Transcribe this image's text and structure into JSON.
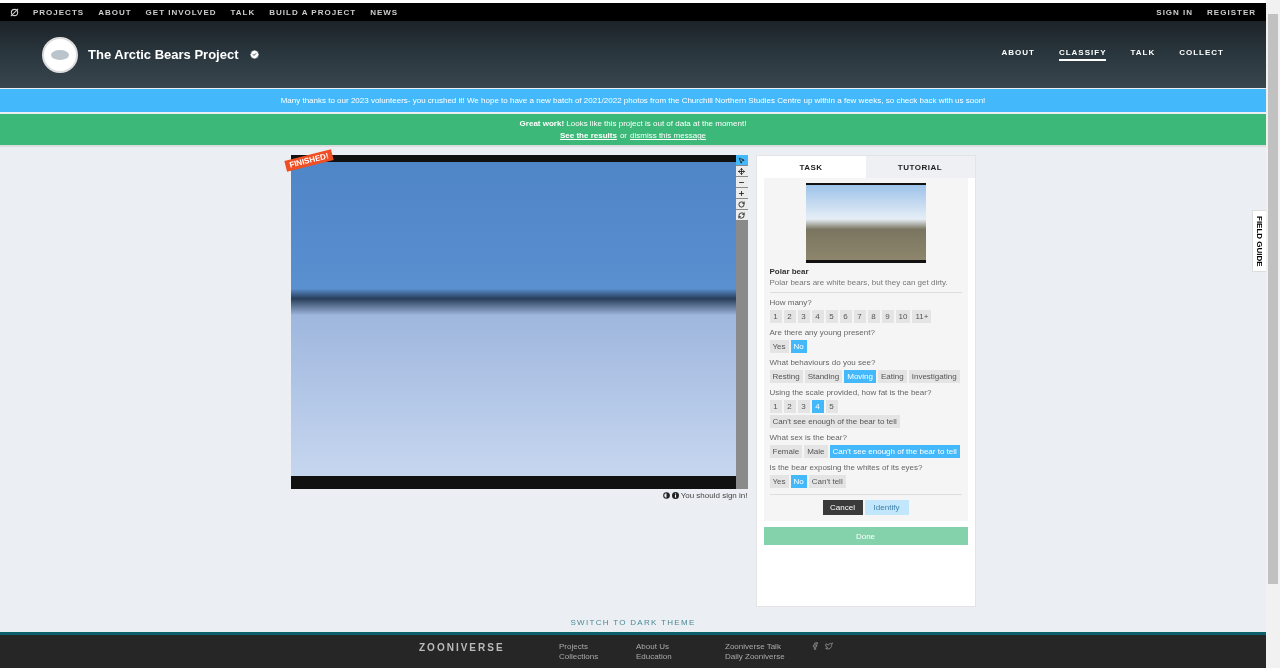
{
  "top_nav": {
    "links": [
      "PROJECTS",
      "ABOUT",
      "GET INVOLVED",
      "TALK",
      "BUILD A PROJECT",
      "NEWS"
    ],
    "account": [
      "SIGN IN",
      "REGISTER"
    ]
  },
  "project": {
    "title": "The Arctic Bears Project",
    "verified": true,
    "nav": [
      {
        "label": "ABOUT",
        "selected": false
      },
      {
        "label": "CLASSIFY",
        "selected": true
      },
      {
        "label": "TALK",
        "selected": false
      },
      {
        "label": "COLLECT",
        "selected": false
      }
    ]
  },
  "announcement": "Many thanks to our 2023 volunteers- you crushed it! We hope to have a new batch of 2021/2022 photos from the Churchill Northern Studies Centre up within a few weeks, so check back with us soon!",
  "finished_banner": {
    "message": "**Great work!** Looks like this project is out of data at the moment!",
    "results_link": "See the results",
    "or": "or",
    "dismiss_link": "dismiss this message"
  },
  "subject": {
    "badge": "FINISHED!",
    "sign_in_note": "You should sign in!",
    "tools": [
      {
        "kind": "pointer",
        "selected": true
      },
      {
        "kind": "move",
        "selected": false
      },
      {
        "kind": "zoom-out",
        "selected": false
      },
      {
        "kind": "zoom-in",
        "selected": false
      },
      {
        "kind": "rotate",
        "selected": false
      },
      {
        "kind": "reset",
        "selected": false
      }
    ]
  },
  "task_panel": {
    "tabs": [
      {
        "label": "TASK",
        "selected": true
      },
      {
        "label": "TUTORIAL",
        "selected": false
      }
    ],
    "species": "Polar bear",
    "description": "Polar bears are white bears, but they can get dirty.",
    "questions": [
      {
        "question": "How many?",
        "options": [
          {
            "label": "1",
            "selected": false
          },
          {
            "label": "2",
            "selected": false
          },
          {
            "label": "3",
            "selected": false
          },
          {
            "label": "4",
            "selected": false
          },
          {
            "label": "5",
            "selected": false
          },
          {
            "label": "6",
            "selected": false
          },
          {
            "label": "7",
            "selected": false
          },
          {
            "label": "8",
            "selected": false
          },
          {
            "label": "9",
            "selected": false
          },
          {
            "label": "10",
            "selected": false
          },
          {
            "label": "11+",
            "selected": false
          }
        ]
      },
      {
        "question": "Are there any young present?",
        "options": [
          {
            "label": "Yes",
            "selected": false
          },
          {
            "label": "No",
            "selected": true
          }
        ]
      },
      {
        "question": "What behaviours do you see?",
        "options": [
          {
            "label": "Resting",
            "selected": false
          },
          {
            "label": "Standing",
            "selected": false
          },
          {
            "label": "Moving",
            "selected": true
          },
          {
            "label": "Eating",
            "selected": false
          },
          {
            "label": "Investigating",
            "selected": false
          }
        ]
      },
      {
        "question": "Using the scale provided, how fat is the bear?",
        "options": [
          {
            "label": "1",
            "selected": false
          },
          {
            "label": "2",
            "selected": false
          },
          {
            "label": "3",
            "selected": false
          },
          {
            "label": "4",
            "selected": true
          },
          {
            "label": "5",
            "selected": false
          },
          {
            "label": "Can't see enough of the bear to tell",
            "selected": false
          }
        ]
      },
      {
        "question": "What sex is the bear?",
        "options": [
          {
            "label": "Female",
            "selected": false
          },
          {
            "label": "Male",
            "selected": false
          },
          {
            "label": "Can't see enough of the bear to tell",
            "selected": true
          }
        ]
      },
      {
        "question": "Is the bear exposing the whites of its eyes?",
        "options": [
          {
            "label": "Yes",
            "selected": false
          },
          {
            "label": "No",
            "selected": true
          },
          {
            "label": "Can't tell",
            "selected": false
          }
        ]
      }
    ],
    "cancel": "Cancel",
    "identify": {
      "label": "Identify",
      "disabled": true
    },
    "done": "Done"
  },
  "field_guide": "FIELD GUIDE",
  "theme_switch": "SWITCH TO DARK THEME",
  "footer": {
    "logo": "ZOONIVERSE",
    "columns": [
      [
        "Projects",
        "Collections"
      ],
      [
        "About Us",
        "Education"
      ],
      [
        "Zooniverse Talk",
        "Daily Zooniverse"
      ]
    ]
  }
}
